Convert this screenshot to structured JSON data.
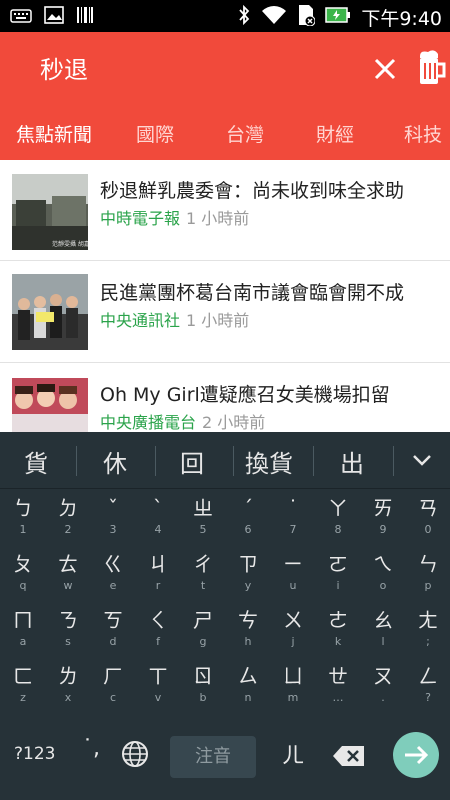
{
  "status_bar": {
    "time": "下午9:40",
    "icons": [
      "keyboard-icon",
      "image-icon",
      "barcode-icon",
      "bluetooth-icon",
      "wifi-icon",
      "sim-icon",
      "battery-charging-icon"
    ]
  },
  "app_bar": {
    "search_query": "秒退",
    "clear_icon": "close-icon",
    "action_icon": "beer-mug-icon"
  },
  "tabs": [
    "焦點新聞",
    "國際",
    "台灣",
    "財經",
    "科技"
  ],
  "active_tab_index": 0,
  "news": [
    {
      "headline": "秒退鮮乳農委會：尚未收到味全求助",
      "source": "中時電子報",
      "time": "1 小時前",
      "thumb_caption": "范靜雯攝  胡嘉鈞攝"
    },
    {
      "headline": "民進黨團杯葛台南市議會臨會開不成",
      "source": "中央通訊社",
      "time": "1 小時前"
    },
    {
      "headline": "Oh My Girl遭疑應召女美機場扣留",
      "source": "中央廣播電台",
      "time": "2 小時前"
    }
  ],
  "keyboard": {
    "suggestions": [
      "貨",
      "休",
      "回",
      "換貨",
      "出"
    ],
    "rows": [
      [
        [
          "ㄅ",
          "1"
        ],
        [
          "ㄉ",
          "2"
        ],
        [
          "ˇ",
          "3"
        ],
        [
          "ˋ",
          "4"
        ],
        [
          "ㄓ",
          "5"
        ],
        [
          "ˊ",
          "6"
        ],
        [
          "˙",
          "7"
        ],
        [
          "ㄚ",
          "8"
        ],
        [
          "ㄞ",
          "9"
        ],
        [
          "ㄢ",
          "0"
        ]
      ],
      [
        [
          "ㄆ",
          "q"
        ],
        [
          "ㄊ",
          "w"
        ],
        [
          "ㄍ",
          "e"
        ],
        [
          "ㄐ",
          "r"
        ],
        [
          "ㄔ",
          "t"
        ],
        [
          "ㄗ",
          "y"
        ],
        [
          "ㄧ",
          "u"
        ],
        [
          "ㄛ",
          "i"
        ],
        [
          "ㄟ",
          "o"
        ],
        [
          "ㄣ",
          "p"
        ]
      ],
      [
        [
          "ㄇ",
          "a"
        ],
        [
          "ㄋ",
          "s"
        ],
        [
          "ㄎ",
          "d"
        ],
        [
          "ㄑ",
          "f"
        ],
        [
          "ㄕ",
          "g"
        ],
        [
          "ㄘ",
          "h"
        ],
        [
          "ㄨ",
          "j"
        ],
        [
          "ㄜ",
          "k"
        ],
        [
          "ㄠ",
          "l"
        ],
        [
          "ㄤ",
          ";"
        ]
      ],
      [
        [
          "ㄈ",
          "z"
        ],
        [
          "ㄌ",
          "x"
        ],
        [
          "ㄏ",
          "c"
        ],
        [
          "ㄒ",
          "v"
        ],
        [
          "ㄖ",
          "b"
        ],
        [
          "ㄙ",
          "n"
        ],
        [
          "ㄩ",
          "m"
        ],
        [
          "ㄝ",
          "…"
        ],
        [
          "ㄡ",
          "."
        ],
        [
          "ㄥ",
          "?"
        ]
      ]
    ],
    "symbols_key": "?123",
    "tone_key": "˙,",
    "space_label": "注音",
    "er_key": "ㄦ",
    "icons": [
      "globe-icon",
      "backspace-icon",
      "enter-arrow-icon",
      "chevron-down-icon"
    ]
  }
}
